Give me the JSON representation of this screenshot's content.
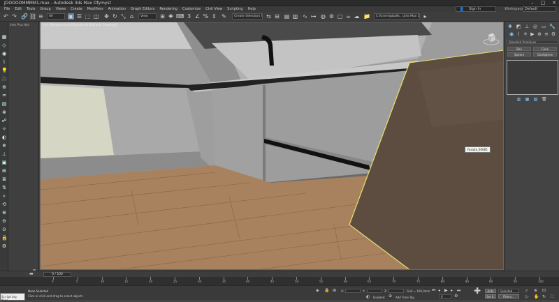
{
  "window": {
    "title": "JDOOOOMMMM1.max - Autodesk 3ds Max Ofymyst",
    "controls": [
      "–",
      "□",
      "✕"
    ]
  },
  "menu": {
    "items": [
      "File",
      "Edit",
      "Tools",
      "Group",
      "Views",
      "Create",
      "Modifiers",
      "Animation",
      "Graph Editors",
      "Rendering",
      "Customize",
      "Civil View",
      "Scripting",
      "Help"
    ]
  },
  "account": {
    "signin_label": "Sign In",
    "workspaces_label": "Workspaces:",
    "workspace_value": "Default"
  },
  "toolbar": {
    "filter_dropdown": "All",
    "view_dropdown": "View",
    "selection_set_placeholder": "Create Selection Set",
    "path_field": "C:\\Users\\pbalik...\\3ds Max 2021"
  },
  "left_panel": {
    "header": "Inter Plus Hair"
  },
  "viewport": {
    "label": "[+] [Perspective] [Standard] [Default Shading]",
    "tooltip": "Fasada_00085"
  },
  "command_panel": {
    "type_dropdown": "Standard Primitives",
    "buttons": [
      "Box",
      "Cone",
      "Sphere",
      "GeoSphere"
    ]
  },
  "timeline": {
    "slider_label": "0 / 100",
    "ticks": [
      "0",
      "5",
      "10",
      "15",
      "20",
      "25",
      "30",
      "35",
      "40",
      "45",
      "50",
      "55",
      "60",
      "65",
      "70",
      "75",
      "80",
      "85",
      "90",
      "95",
      "100"
    ]
  },
  "status": {
    "maxscript_label": "Scripting Mini",
    "selection": "None Selected",
    "prompt": "Click or click-and-drag to select objects",
    "x_label": "X:",
    "y_label": "Y:",
    "z_label": "Z:",
    "grid": "Grid = 100,0mm",
    "add_time_tag": "Add Time Tag",
    "enabled_label": "Enabled:",
    "auto_key": "Auto",
    "set_key": "Set K.",
    "selected_dropdown": "Selected",
    "filters": "Filters...",
    "frame_value": "0"
  },
  "colors": {
    "selection_highlight": "#e8e070",
    "floor_wood": "#a88462",
    "wood_panel": "#5b4c40",
    "ui_dark": "#3a3a3a"
  }
}
